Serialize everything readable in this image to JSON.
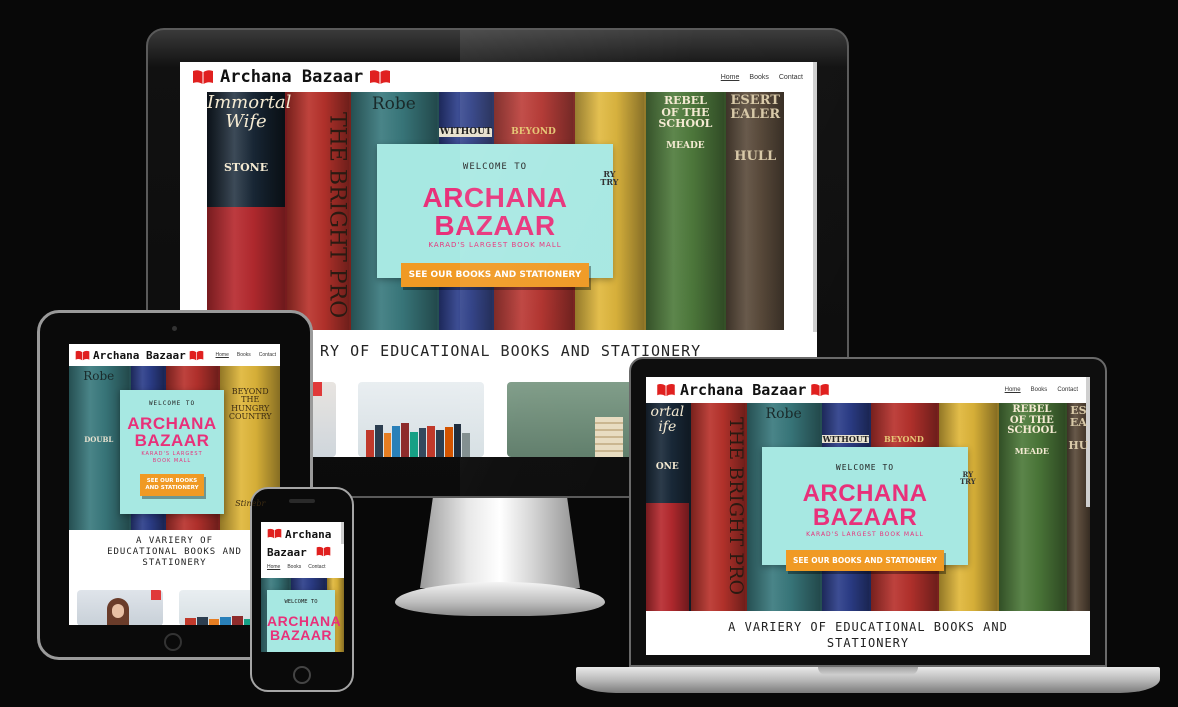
{
  "site": {
    "brand": "Archana Bazaar",
    "brand_line1": "Archana",
    "brand_line2": "Bazaar",
    "nav": [
      "Home",
      "Books",
      "Contact"
    ],
    "welcome": "WELCOME TO",
    "title": "ARCHANA BAZAAR",
    "title_line1": "ARCHANA",
    "title_line2": "BAZAAR",
    "subtitle": "KARAD'S LARGEST BOOK MALL",
    "subtitle_line1": "KARAD'S LARGEST",
    "subtitle_line2": "BOOK MALL",
    "cta": "SEE OUR BOOKS AND STATIONERY",
    "cta_line1": "SEE OUR BOOKS",
    "cta_line2": "AND STATIONERY",
    "tagline": "A VARIERY OF EDUCATIONAL BOOKS AND STATIONERY",
    "tagline_monitor": "RY OF EDUCATIONAL BOOKS AND STATIONERY",
    "tagline_laptop_1": "A VARIERY OF EDUCATIONAL BOOKS AND",
    "tagline_laptop_2": "STATIONERY",
    "tagline_tablet_1": "A VARIERY OF",
    "tagline_tablet_2": "EDUCATIONAL BOOKS AND",
    "tagline_tablet_3": "STATIONERY"
  },
  "spines": {
    "immortal": "Immortal",
    "wife": "Wife",
    "stone": "STONE",
    "bright": "THE BRIGHT PRO",
    "robe": "Robe",
    "without": "WITHOUT",
    "beyond": "BEYOND",
    "ry": "RY",
    "try": "TRY",
    "rebel": "REBEL",
    "of_the": "OF THE",
    "school": "SCHOOL",
    "meade": "MEADE",
    "esert": "ESERT",
    "ealer": "EALER",
    "hull": "HULL",
    "ortal": "ortal",
    "ife": "ife",
    "one": "ONE",
    "hungry": "HUNGRY",
    "country": "COUNTRY",
    "the": "THE",
    "doubl": "DOUBL",
    "stinebr": "Stinebr",
    "dorf": "dorf",
    "es": "ES",
    "ea": "EA",
    "hu": "HU"
  },
  "colors": {
    "accent_pink": "#e8317a",
    "welcome_bg": "#a7e8e2",
    "cta_orange": "#f09a24",
    "brand_red": "#e0201f"
  },
  "icons": {
    "brand": "open-book-icon"
  }
}
